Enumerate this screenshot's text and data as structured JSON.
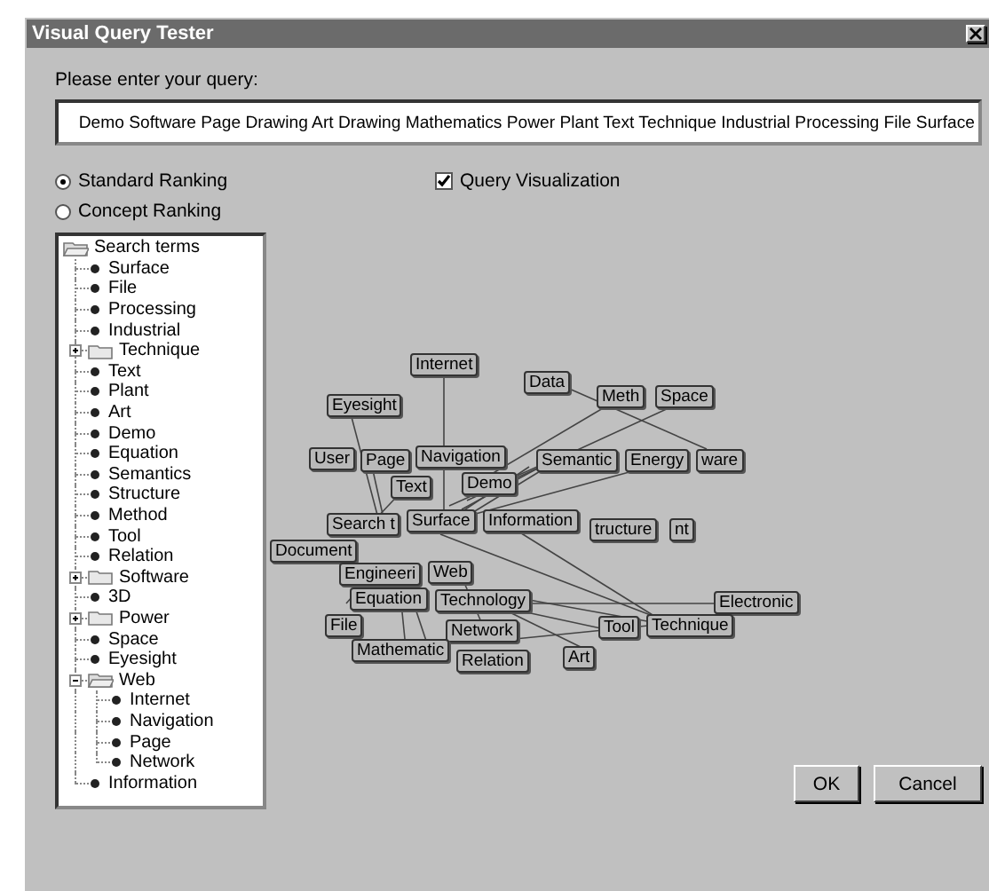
{
  "window": {
    "title": "Visual Query Tester"
  },
  "query": {
    "label": "Please enter your query:",
    "value": "Demo Software Page Drawing Art Drawing Mathematics Power Plant Text Technique Industrial Processing File Surface"
  },
  "ranking": [
    {
      "label": "Standard Ranking",
      "selected": true
    },
    {
      "label": "Concept Ranking",
      "selected": false
    }
  ],
  "visualization": {
    "label": "Query Visualization",
    "checked": true
  },
  "tree": {
    "label": "Search terms",
    "expanded": true,
    "children": [
      {
        "label": "Surface",
        "kind": "leaf"
      },
      {
        "label": "File",
        "kind": "leaf"
      },
      {
        "label": "Processing",
        "kind": "leaf"
      },
      {
        "label": "Industrial",
        "kind": "leaf"
      },
      {
        "label": "Technique",
        "kind": "folder",
        "expanded": false
      },
      {
        "label": "Text",
        "kind": "leaf"
      },
      {
        "label": "Plant",
        "kind": "leaf"
      },
      {
        "label": "Art",
        "kind": "leaf"
      },
      {
        "label": "Demo",
        "kind": "leaf"
      },
      {
        "label": "Equation",
        "kind": "leaf"
      },
      {
        "label": "Semantics",
        "kind": "leaf"
      },
      {
        "label": "Structure",
        "kind": "leaf"
      },
      {
        "label": "Method",
        "kind": "leaf"
      },
      {
        "label": "Tool",
        "kind": "leaf"
      },
      {
        "label": "Relation",
        "kind": "leaf"
      },
      {
        "label": "Software",
        "kind": "folder",
        "expanded": false
      },
      {
        "label": "3D",
        "kind": "leaf"
      },
      {
        "label": "Power",
        "kind": "folder",
        "expanded": false
      },
      {
        "label": "Space",
        "kind": "leaf"
      },
      {
        "label": "Eyesight",
        "kind": "leaf"
      },
      {
        "label": "Web",
        "kind": "folder",
        "expanded": true,
        "children": [
          {
            "label": "Internet",
            "kind": "leaf"
          },
          {
            "label": "Navigation",
            "kind": "leaf"
          },
          {
            "label": "Page",
            "kind": "leaf"
          },
          {
            "label": "Network",
            "kind": "leaf"
          }
        ]
      },
      {
        "label": "Information",
        "kind": "leaf"
      }
    ]
  },
  "graph": {
    "nodes": [
      {
        "label": "Internet"
      },
      {
        "label": "Data"
      },
      {
        "label": "Meth"
      },
      {
        "label": "Space"
      },
      {
        "label": "Eyesight"
      },
      {
        "label": "User"
      },
      {
        "label": "Page"
      },
      {
        "label": "Navigation"
      },
      {
        "label": "Semantic"
      },
      {
        "label": "Energy"
      },
      {
        "label": "ware"
      },
      {
        "label": "Text"
      },
      {
        "label": "Demo"
      },
      {
        "label": "Search t"
      },
      {
        "label": "Surface"
      },
      {
        "label": "Information"
      },
      {
        "label": "tructure"
      },
      {
        "label": "nt"
      },
      {
        "label": "Document"
      },
      {
        "label": "Engineeri"
      },
      {
        "label": "Web"
      },
      {
        "label": "Equation"
      },
      {
        "label": "Technology"
      },
      {
        "label": "Electronic"
      },
      {
        "label": "File"
      },
      {
        "label": "Network"
      },
      {
        "label": "Tool"
      },
      {
        "label": "Technique"
      },
      {
        "label": "Mathematic"
      },
      {
        "label": "Relation"
      },
      {
        "label": "Art"
      }
    ]
  },
  "buttons": [
    "OK",
    "Cancel"
  ]
}
